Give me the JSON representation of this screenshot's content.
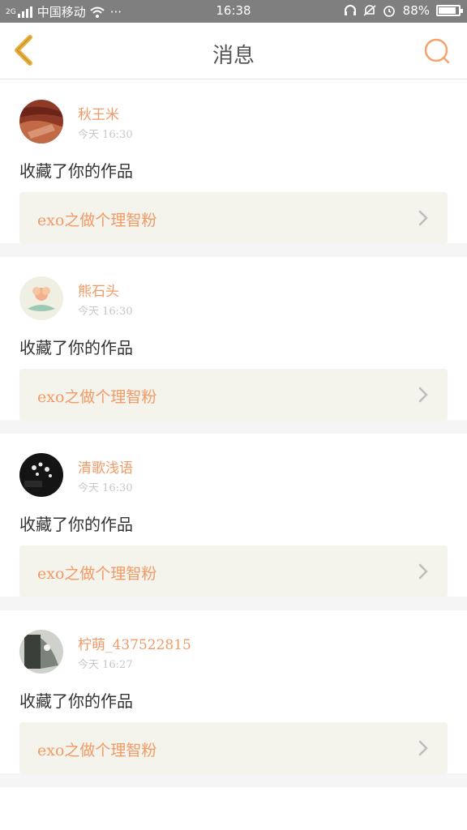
{
  "status_bar": {
    "carrier": "中国移动",
    "net": "2G",
    "more": "···",
    "time": "16:38",
    "battery": "88%",
    "battery_level": 0.88,
    "icons": [
      "signal-icon",
      "wifi-icon",
      "headset-icon",
      "mute-icon",
      "alarm-icon",
      "battery-icon"
    ]
  },
  "nav": {
    "title": "消息",
    "back_icon": "chevron-left-icon",
    "search_icon": "search-icon"
  },
  "colors": {
    "accent": "#f29a66",
    "back_arrow": "#e8b03a",
    "card_link_bg": "#f4f3ec",
    "separator": "#f5f5f5"
  },
  "messages": [
    {
      "user": "秋王米",
      "time": "今天  16:30",
      "action": "收藏了你的作品",
      "work": "exo之做个理智粉"
    },
    {
      "user": "熊石头",
      "time": "今天  16:30",
      "action": "收藏了你的作品",
      "work": "exo之做个理智粉"
    },
    {
      "user": "清歌浅语",
      "time": "今天  16:30",
      "action": "收藏了你的作品",
      "work": "exo之做个理智粉"
    },
    {
      "user": "柠萌_437522815",
      "time": "今天  16:27",
      "action": "收藏了你的作品",
      "work": "exo之做个理智粉"
    }
  ]
}
